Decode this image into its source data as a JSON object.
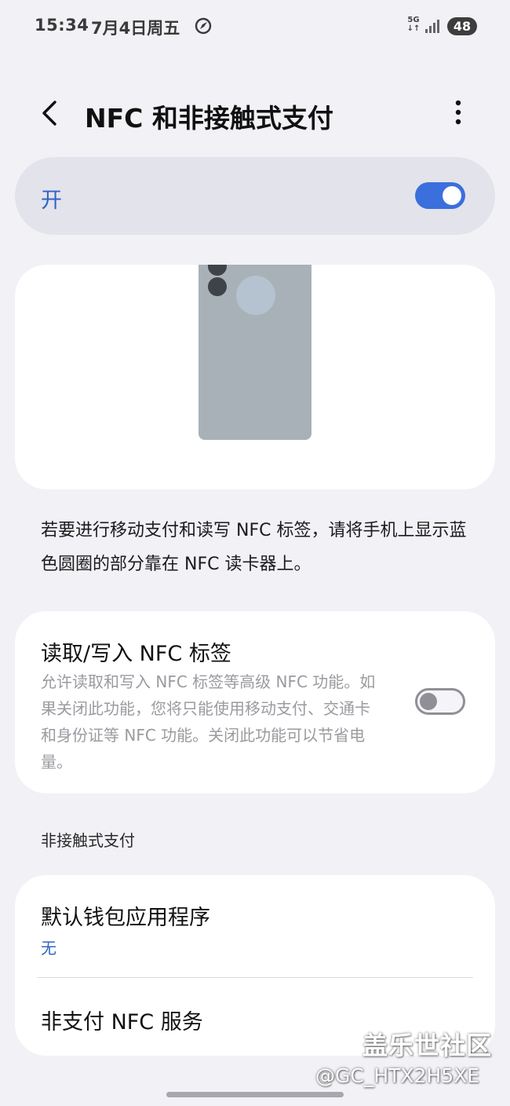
{
  "status_bar": {
    "time": "15:34",
    "date": "7月4日周五",
    "network": "5G",
    "battery": "48"
  },
  "header": {
    "title": "NFC 和非接触式支付",
    "back_icon": "chevron-left-icon",
    "more_icon": "more-vertical-icon"
  },
  "master_switch": {
    "label": "开",
    "state": "on",
    "accent_color": "#3b6fdc"
  },
  "hint": {
    "text": "若要进行移动支付和读写 NFC 标签，请将手机上显示蓝色圆圈的部分靠在 NFC 读卡器上。"
  },
  "read_write": {
    "title": "读取/写入 NFC 标签",
    "description": "允许读取和写入 NFC 标签等高级 NFC 功能。如果关闭此功能，您将只能使用移动支付、交通卡和身份证等 NFC 功能。关闭此功能可以节省电量。",
    "state": "off"
  },
  "contactless": {
    "section_label": "非接触式支付",
    "default_wallet": {
      "title": "默认钱包应用程序",
      "value": "无"
    },
    "non_payment": {
      "title": "非支付 NFC 服务"
    }
  },
  "watermark": {
    "site": "盖乐世社区",
    "user": "@GC_HTX2H5XE"
  }
}
